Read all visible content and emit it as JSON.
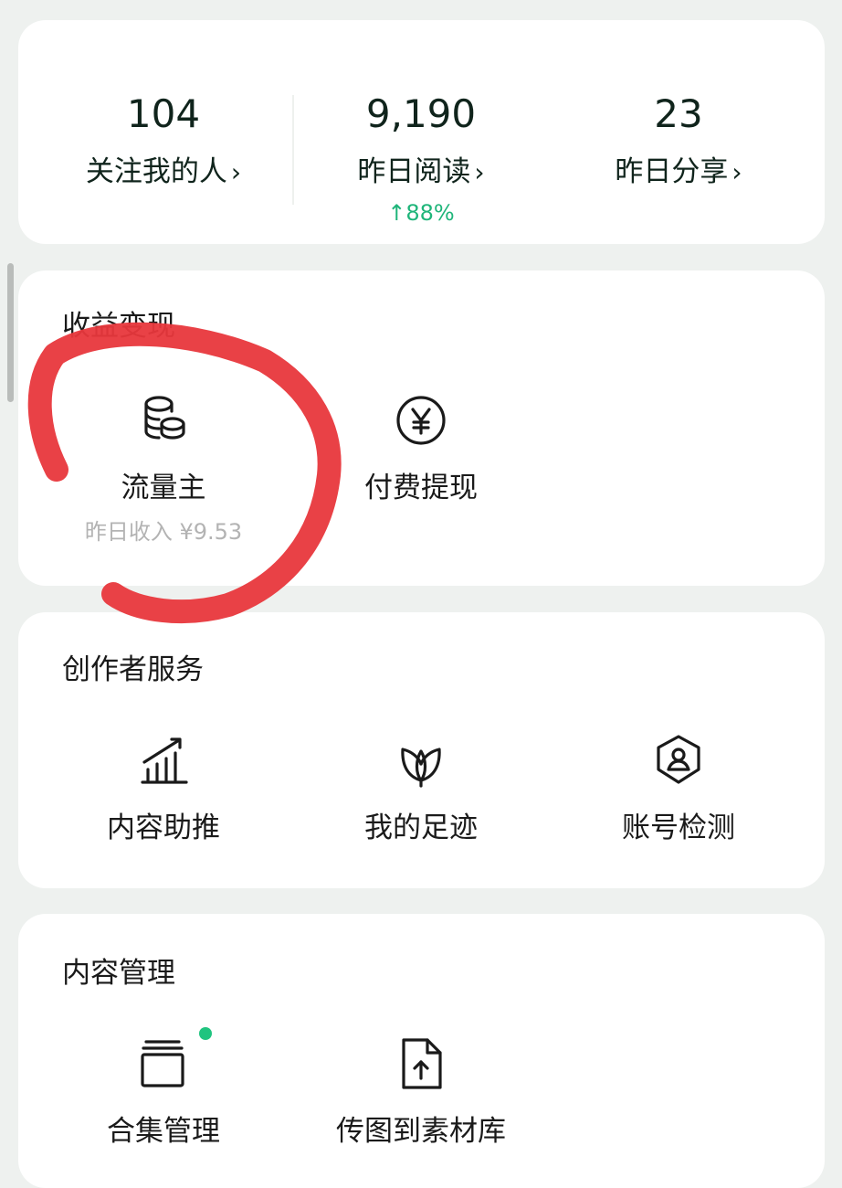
{
  "stats": [
    {
      "value": "104",
      "label": "关注我的人",
      "chevron": "›"
    },
    {
      "value": "9,190",
      "label": "昨日阅读",
      "chevron": "›",
      "trend": "↑88%"
    },
    {
      "value": "23",
      "label": "昨日分享",
      "chevron": "›"
    }
  ],
  "monetization": {
    "title": "收益变现",
    "items": [
      {
        "label": "流量主",
        "sub": "昨日收入 ¥9.53",
        "icon": "coins-icon"
      },
      {
        "label": "付费提现",
        "icon": "yen-circle-icon"
      }
    ]
  },
  "creator_services": {
    "title": "创作者服务",
    "items": [
      {
        "label": "内容助推",
        "icon": "growth-chart-icon"
      },
      {
        "label": "我的足迹",
        "icon": "leaf-icon"
      },
      {
        "label": "账号检测",
        "icon": "shield-user-icon"
      }
    ]
  },
  "content_management": {
    "title": "内容管理",
    "items": [
      {
        "label": "合集管理",
        "icon": "collection-stack-icon",
        "has_new_badge": true
      },
      {
        "label": "传图到素材库",
        "icon": "upload-file-icon"
      }
    ]
  },
  "colors": {
    "background": "#eef1ef",
    "card": "#ffffff",
    "primary_text": "#10241c",
    "trend_up": "#1fb57a",
    "badge": "#1fc47f",
    "annotation": "#e8373c"
  }
}
